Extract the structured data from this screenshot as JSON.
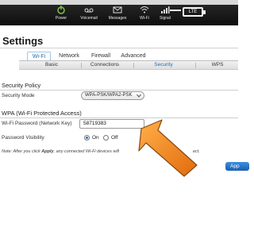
{
  "status_bar": {
    "items": [
      {
        "label": "Power",
        "icon": "power-icon"
      },
      {
        "label": "Voicemail",
        "icon": "voicemail-icon"
      },
      {
        "label": "Messages",
        "icon": "messages-icon"
      },
      {
        "label": "Wi-Fi",
        "icon": "wifi-icon"
      },
      {
        "label": "Signal",
        "icon": "signal-icon"
      }
    ],
    "battery_text": "LTE",
    "icon_color": "#7cc242"
  },
  "page": {
    "title": "Settings"
  },
  "tabs": [
    {
      "label": "Wi-Fi",
      "active": true
    },
    {
      "label": "Network",
      "active": false
    },
    {
      "label": "Firewall",
      "active": false
    },
    {
      "label": "Advanced",
      "active": false
    }
  ],
  "subtabs": [
    {
      "label": "Basic",
      "active": false
    },
    {
      "label": "Connections",
      "active": false
    },
    {
      "label": "Security",
      "active": true
    },
    {
      "label": "WPS",
      "active": false
    }
  ],
  "security_policy": {
    "heading": "Security Policy",
    "mode_label": "Security Mode",
    "mode_value": "WPA-PSK/WPA2-PSK"
  },
  "wpa": {
    "heading": "WPA (Wi-Fi Protected Access)",
    "password_label": "Wi-Fi Password (Network Key)",
    "password_value": "58719383",
    "visibility_label": "Password Visibility",
    "visibility_on": "On",
    "visibility_off": "Off",
    "visibility_selected": "On"
  },
  "note": {
    "prefix": "Note: After you click ",
    "apply_word": "Apply",
    "suffix": ", any connected Wi-Fi devices will",
    "tail": "ect."
  },
  "apply_button": {
    "label": "App"
  },
  "colors": {
    "accent": "#1d6bb5",
    "arrow": "#f28a1e"
  }
}
